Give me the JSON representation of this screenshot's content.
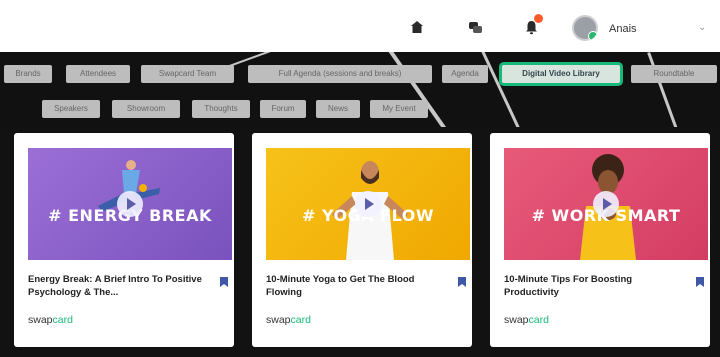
{
  "header": {
    "user_name": "Anais",
    "icons": [
      "home-icon",
      "chat-icon",
      "notifications-icon"
    ],
    "accent_color": "#17b979"
  },
  "nav": {
    "row1": [
      {
        "label": "Brands"
      },
      {
        "label": "Attendees"
      },
      {
        "label": "Swapcard Team"
      },
      {
        "label": "Full Agenda (sessions and breaks)"
      },
      {
        "label": "Agenda"
      },
      {
        "label": "Digital Video Library",
        "active": true
      },
      {
        "label": "Roundtable"
      }
    ],
    "row2": [
      {
        "label": "Speakers"
      },
      {
        "label": "Showroom"
      },
      {
        "label": "Thoughts"
      },
      {
        "label": "Forum"
      },
      {
        "label": "News"
      },
      {
        "label": "My Event"
      }
    ]
  },
  "cards": [
    {
      "thumb_text": "# ENERGY BREAK",
      "title": "Energy Break: A Brief Intro To Positive Psychology & The...",
      "thumb_color": "#8d63c9"
    },
    {
      "thumb_text": "# YOGA FLOW",
      "title": "10-Minute Yoga to Get The Blood Flowing",
      "thumb_color": "#f4b400"
    },
    {
      "thumb_text": "# WORK SMART",
      "title": "10-Minute Tips For Boosting Productivity",
      "thumb_color": "#e2496b"
    }
  ],
  "brand": {
    "prefix": "swap",
    "suffix": "card"
  }
}
